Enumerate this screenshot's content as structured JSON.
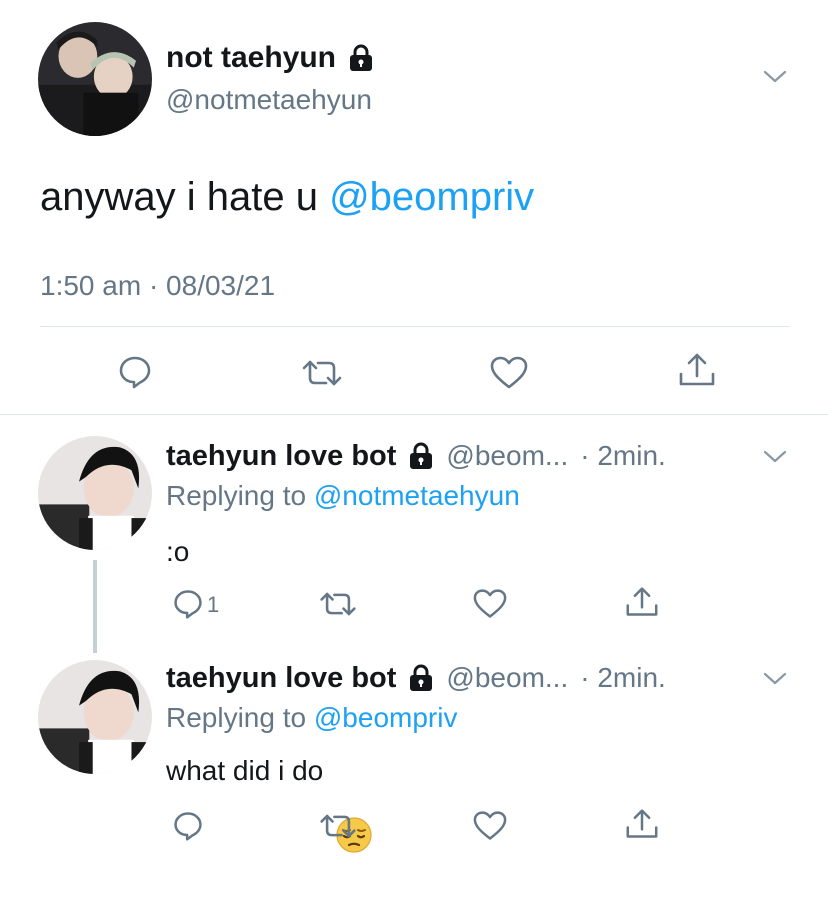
{
  "main_tweet": {
    "display_name": "not taehyun",
    "handle": "@notmetaehyun",
    "text": "anyway i hate u ",
    "mention": "@beompriv",
    "timestamp": "1:50 am · 08/03/21",
    "lock_icon": "lock-icon",
    "menu_icon": "chevron-down-icon"
  },
  "replies": [
    {
      "display_name": "taehyun love bot",
      "handle": "@beom...",
      "time": "· 2min.",
      "replying_prefix": "Replying to ",
      "replying_to": "@notmetaehyun",
      "text": ":o",
      "reply_count": "1"
    },
    {
      "display_name": "taehyun love bot",
      "handle": "@beom...",
      "time": "· 2min.",
      "replying_prefix": "Replying to ",
      "replying_to": "@beompriv",
      "text": "what did i do",
      "emoji": "😔"
    }
  ],
  "colors": {
    "link_blue": "#1da1f2",
    "secondary_grey": "#657786",
    "icon_grey": "#657786",
    "divider": "#e1e8ed"
  }
}
